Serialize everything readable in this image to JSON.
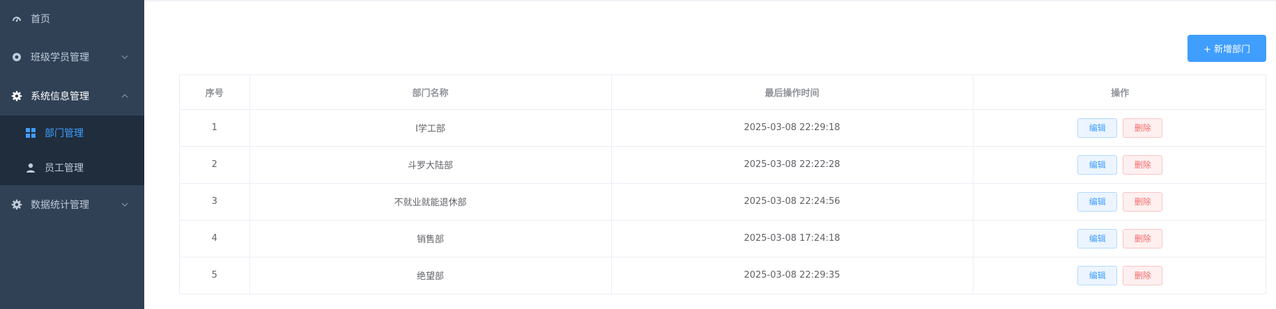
{
  "sidebar": {
    "items": [
      {
        "label": "首页",
        "icon": "dashboard-icon"
      },
      {
        "label": "班级学员管理",
        "icon": "circle-icon"
      },
      {
        "label": "系统信息管理",
        "icon": "gear-icon",
        "expanded": true,
        "children": [
          {
            "label": "部门管理",
            "icon": "grid-icon",
            "active": true
          },
          {
            "label": "员工管理",
            "icon": "user-icon"
          }
        ]
      },
      {
        "label": "数据统计管理",
        "icon": "gear-icon"
      }
    ]
  },
  "toolbar": {
    "add_label": "+ 新增部门"
  },
  "table": {
    "headers": [
      "序号",
      "部门名称",
      "最后操作时间",
      "操作"
    ],
    "edit_label": "编辑",
    "delete_label": "删除",
    "rows": [
      {
        "index": "1",
        "name": "I学工部",
        "time": "2025-03-08 22:29:18"
      },
      {
        "index": "2",
        "name": "斗罗大陆部",
        "time": "2025-03-08 22:22:28"
      },
      {
        "index": "3",
        "name": "不就业就能退休部",
        "time": "2025-03-08 22:24:56"
      },
      {
        "index": "4",
        "name": "销售部",
        "time": "2025-03-08 17:24:18"
      },
      {
        "index": "5",
        "name": "绝望部",
        "time": "2025-03-08 22:29:35"
      }
    ]
  },
  "colors": {
    "sidebar_bg": "#304156",
    "submenu_bg": "#1f2d3d",
    "accent": "#409eff",
    "danger": "#f56c6c"
  }
}
